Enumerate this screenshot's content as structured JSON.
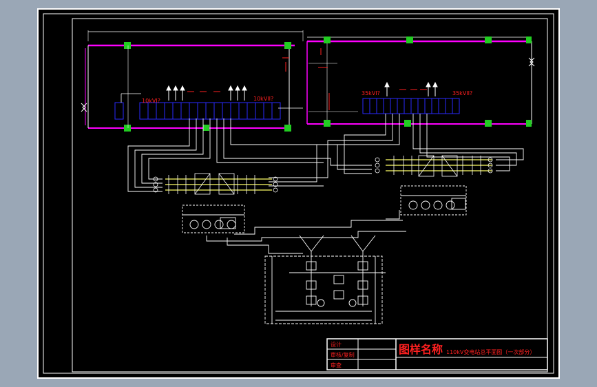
{
  "drawing": {
    "room_left": {
      "busbar_label_left": "10kVI?",
      "busbar_label_right": "10kVII?"
    },
    "room_right": {
      "busbar_label_left": "35kVI?",
      "busbar_label_right": "35kVII?"
    }
  },
  "title_block": {
    "row_labels": [
      "设计",
      "审核/复制",
      "审查"
    ],
    "big_title": "图样名称",
    "subtitle": "110kV变电站总平面图（一次部分）"
  },
  "colors": {
    "sheet_background": "#000000",
    "frame": "#ffffff",
    "wall": "#ff00ff",
    "equipment": "#0000ff",
    "label": "#ff2020",
    "connector": "#00cc00",
    "busbar": "#ffff00",
    "outer_background": "#9aa7b6"
  }
}
